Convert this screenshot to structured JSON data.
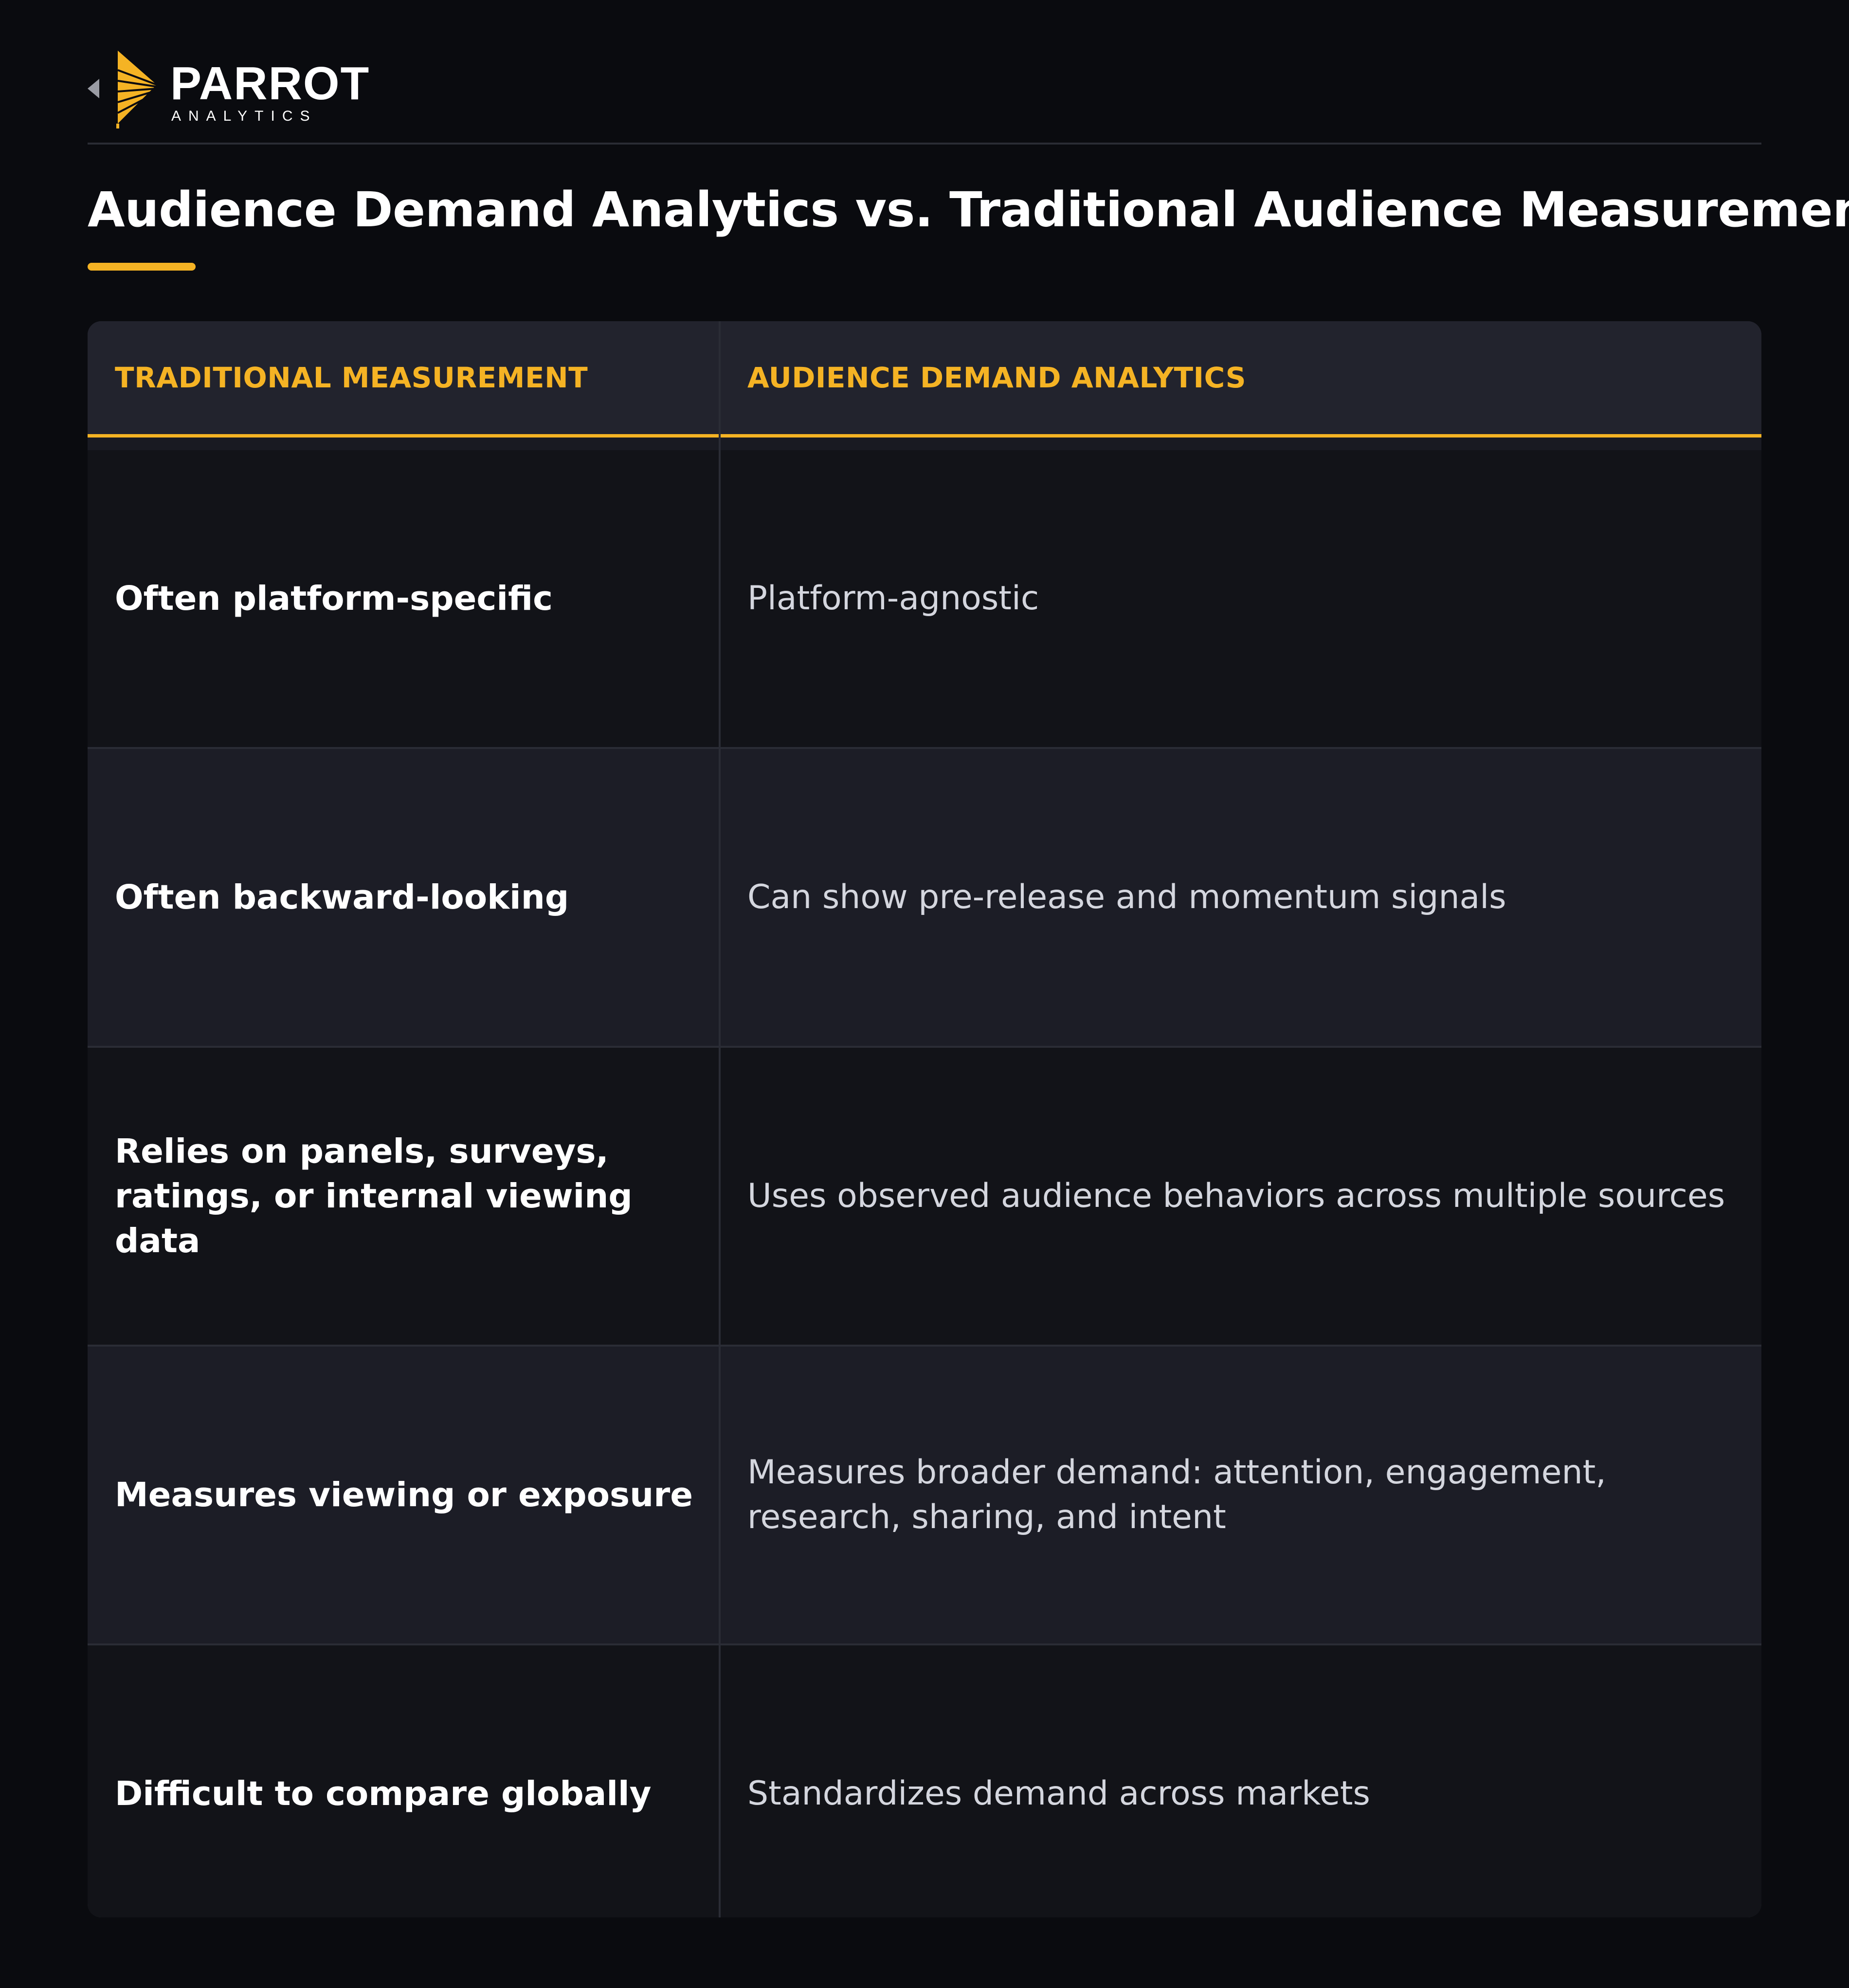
{
  "brand": {
    "name": "PARROT",
    "tagline": "ANALYTICS",
    "accent_color": "#f5b324",
    "logo_icon": "parrot-logo-icon"
  },
  "page": {
    "title": "Audience Demand Analytics vs. Traditional Audience Measurement"
  },
  "table": {
    "headers": [
      "TRADITIONAL MEASUREMENT",
      "AUDIENCE DEMAND ANALYTICS"
    ],
    "rows": [
      {
        "traditional": "Often platform-specific",
        "demand": "Platform-agnostic"
      },
      {
        "traditional": "Often backward-looking",
        "demand": "Can show pre-release and momentum signals"
      },
      {
        "traditional": "Relies on panels, surveys, ratings, or internal viewing data",
        "demand": "Uses observed audience behaviors across multiple sources"
      },
      {
        "traditional": "Measures viewing or exposure",
        "demand": "Measures broader demand: attention, engagement, research, sharing, and intent"
      },
      {
        "traditional": "Difficult to compare globally",
        "demand": "Standardizes demand across markets"
      }
    ]
  },
  "colors": {
    "background": "#0a0b0f",
    "header_text": "#f5b324",
    "row_odd": "#121318",
    "row_even": "#1c1d26"
  }
}
